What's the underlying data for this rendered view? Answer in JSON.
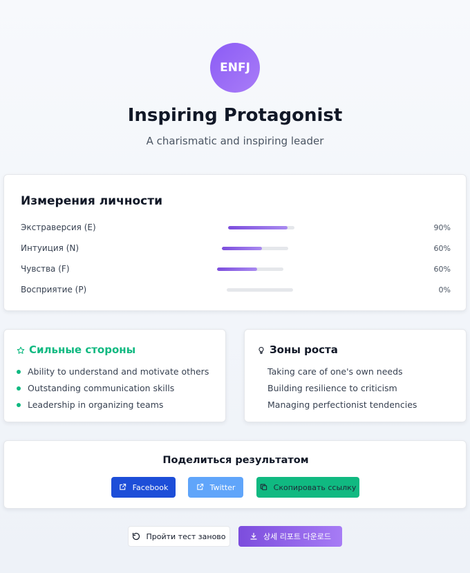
{
  "hero": {
    "badge": "ENFJ",
    "title": "Inspiring Protagonist",
    "subtitle": "A charismatic and inspiring leader"
  },
  "dimensions": {
    "title": "Измерения личности",
    "items": [
      {
        "label": "Экстраверсия (E)",
        "value_text": "90%",
        "fill_fraction": 0.9
      },
      {
        "label": "Интуиция (N)",
        "value_text": "60%",
        "fill_fraction": 0.6
      },
      {
        "label": "Чувства (F)",
        "value_text": "60%",
        "fill_fraction": 0.6
      },
      {
        "label": "Восприятие (P)",
        "value_text": "0%",
        "fill_fraction": 0
      }
    ]
  },
  "strengths": {
    "title": "Сильные стороны",
    "items": [
      "Ability to understand and motivate others",
      "Outstanding communication skills",
      "Leadership in organizing teams"
    ]
  },
  "growth": {
    "title": "Зоны роста",
    "items": [
      "Taking care of one's own needs",
      "Building resilience to criticism",
      "Managing perfectionist tendencies"
    ]
  },
  "share": {
    "title": "Поделиться результатом",
    "facebook": "Facebook",
    "twitter": "Twitter",
    "copy": "Скопировать ссылку"
  },
  "actions": {
    "retry": "Пройти тест заново",
    "report": "상세 리포트 다운로드"
  },
  "colors": {
    "accent": "#8b5cf6",
    "success": "#10b981",
    "facebook": "#1d4ed8",
    "twitter": "#60a5fa"
  }
}
